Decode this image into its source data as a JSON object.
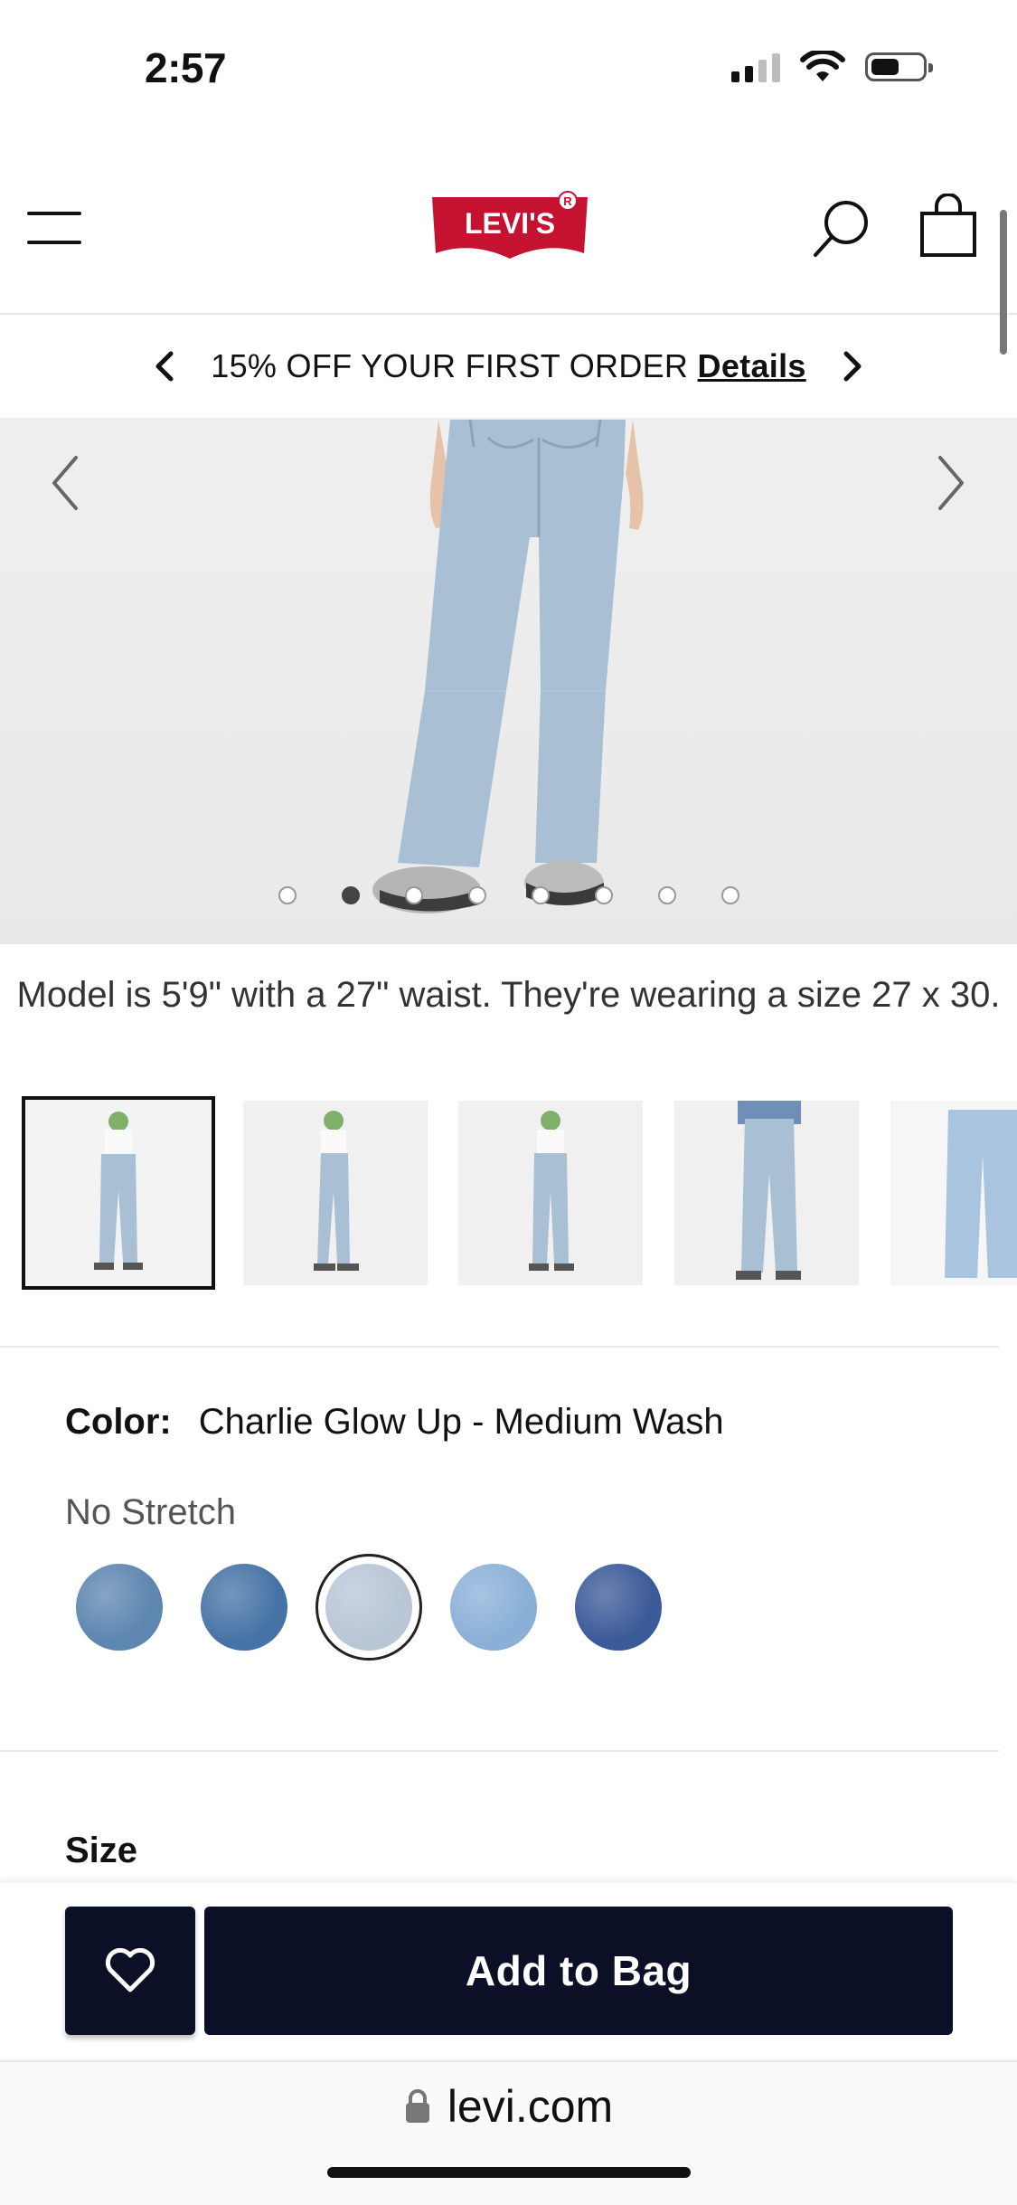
{
  "status_bar": {
    "time": "2:57"
  },
  "header": {
    "brand": "Levi's",
    "menu_icon": "hamburger-menu-icon",
    "search_icon": "search-icon",
    "bag_icon": "shopping-bag-icon"
  },
  "promo": {
    "text": "15% OFF YOUR FIRST ORDER",
    "link": "Details"
  },
  "gallery": {
    "image_count": 8,
    "active_index": 1,
    "caption": "Model is 5'9\" with a 27\" waist. They're wearing a size 27 x 30.",
    "thumbnails": [
      "front",
      "side",
      "back",
      "front-jacket",
      "flat"
    ]
  },
  "product": {
    "color_label": "Color:",
    "color_value": "Charlie Glow Up - Medium Wash",
    "stretch_label": "No Stretch",
    "swatches": [
      "#5d86b0",
      "#4673a6",
      "#b8c6d6",
      "#8ab0d8",
      "#3b5a98"
    ],
    "selected_swatch": 2,
    "size_label": "Size"
  },
  "actions": {
    "add_to_bag": "Add to Bag",
    "wishlist_icon": "heart-icon"
  },
  "browser": {
    "url": "levi.com"
  },
  "colors": {
    "brand_red": "#c41230",
    "button_navy": "#0b1026"
  }
}
